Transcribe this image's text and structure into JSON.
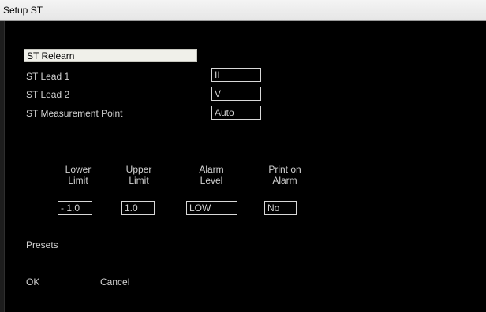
{
  "window": {
    "title": "Setup ST"
  },
  "settings": {
    "relearn_label": "ST Relearn",
    "lead1_label": "ST Lead 1",
    "lead1_value": "II",
    "lead2_label": "ST Lead 2",
    "lead2_value": "V",
    "measurement_label": "ST Measurement Point",
    "measurement_value": "Auto"
  },
  "limits": {
    "lower": {
      "line1": "Lower",
      "line2": "Limit",
      "value": "- 1.0"
    },
    "upper": {
      "line1": "Upper",
      "line2": "Limit",
      "value": "1.0"
    },
    "alarm_level": {
      "line1": "Alarm",
      "line2": "Level",
      "value": "LOW"
    },
    "print_on_alarm": {
      "line1": "Print on",
      "line2": "Alarm",
      "value": "No"
    }
  },
  "actions": {
    "presets": "Presets",
    "ok": "OK",
    "cancel": "Cancel"
  },
  "colors": {
    "background": "#000000",
    "text": "#d2d2d2",
    "selection": "#f0f0ea",
    "titlebar": "#eeeeee"
  }
}
